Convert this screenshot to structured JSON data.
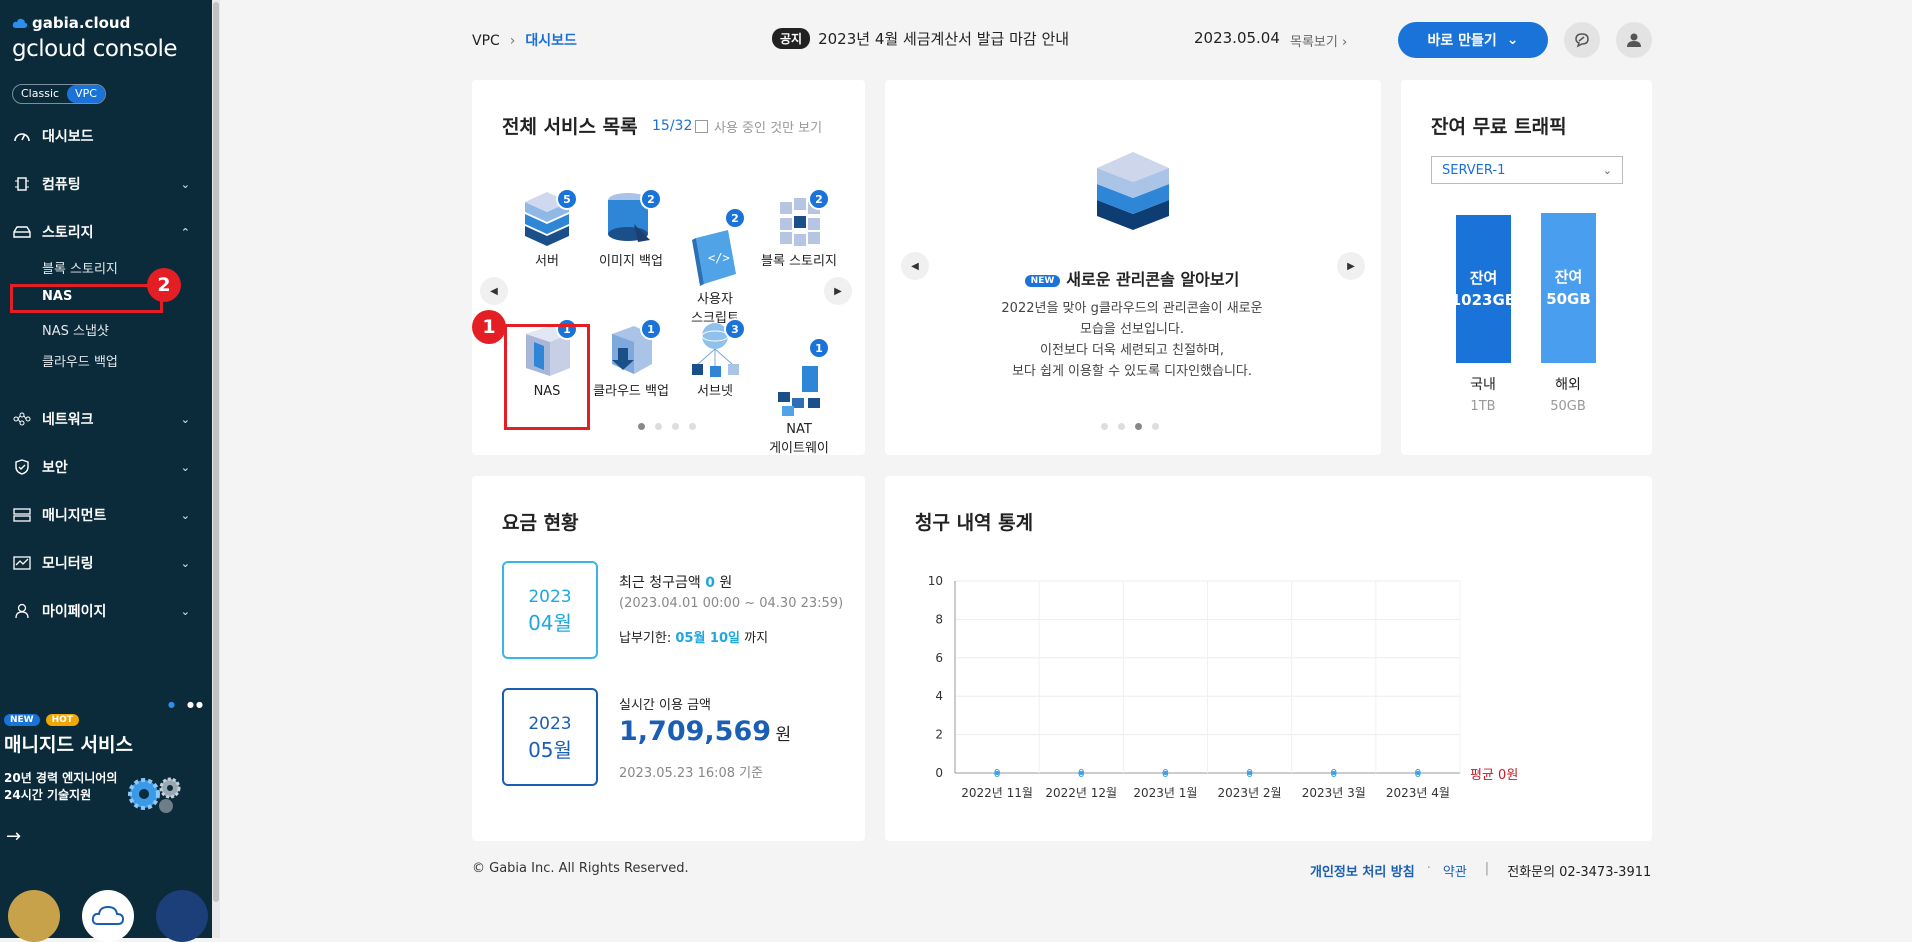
{
  "sidebar": {
    "logo_small": "gabia.cloud",
    "logo_main": "gcloud console",
    "toggle": [
      "Classic",
      "VPC"
    ],
    "menu": [
      {
        "label": "대시보드",
        "icon": "dashboard-icon"
      },
      {
        "label": "컴퓨팅",
        "icon": "chip-icon"
      },
      {
        "label": "스토리지",
        "icon": "storage-icon"
      },
      {
        "label": "네트워크",
        "icon": "network-icon"
      },
      {
        "label": "보안",
        "icon": "shield-icon"
      },
      {
        "label": "매니지먼트",
        "icon": "management-icon"
      },
      {
        "label": "모니터링",
        "icon": "monitoring-icon"
      },
      {
        "label": "마이페이지",
        "icon": "user-icon"
      }
    ],
    "storage_sub": [
      "블록 스토리지",
      "NAS",
      "NAS 스냅샷",
      "클라우드 백업"
    ],
    "promo": {
      "tag_new": "NEW",
      "tag_hot": "HOT",
      "title": "매니지드 서비스",
      "desc1": "20년 경력 엔지니어의",
      "desc2": "24시간 기술지원"
    }
  },
  "annotations": {
    "step1": "1",
    "step2": "2"
  },
  "header": {
    "breadcrumb_root": "VPC",
    "breadcrumb_current": "대시보드",
    "notice_label": "공지",
    "notice_text": "2023년 4월 세금계산서 발급 마감 안내",
    "notice_date": "2023.05.04",
    "notice_more": "목록보기",
    "create_button": "바로 만들기"
  },
  "services": {
    "title": "전체 서비스 목록",
    "count": "15/32",
    "filter_label": "사용 중인 것만 보기",
    "items": [
      {
        "name": "서버",
        "count": "5",
        "icon": "server-icon"
      },
      {
        "name": "이미지 백업",
        "count": "2",
        "icon": "image-backup-icon"
      },
      {
        "name": "사용자\n스크립트",
        "count": "2",
        "icon": "user-script-icon"
      },
      {
        "name": "블록 스토리지",
        "count": "2",
        "icon": "block-storage-icon"
      },
      {
        "name": "NAS",
        "count": "1",
        "icon": "nas-icon"
      },
      {
        "name": "클라우드 백업",
        "count": "1",
        "icon": "cloud-backup-icon"
      },
      {
        "name": "서브넷",
        "count": "3",
        "icon": "subnet-icon"
      },
      {
        "name": "NAT\n게이트웨이",
        "count": "1",
        "icon": "nat-gateway-icon"
      }
    ]
  },
  "slide": {
    "new_tag": "NEW",
    "title": "새로운 관리콘솔 알아보기",
    "lines": [
      "2022년을 맞아 g클라우드의 관리콘솔이 새로운",
      "모습을 선보입니다.",
      "이전보다 더욱 세련되고 친절하며,",
      "보다 쉽게 이용할 수 있도록 디자인했습니다."
    ]
  },
  "traffic": {
    "title": "잔여 무료 트래픽",
    "select": "SERVER-1",
    "domestic": {
      "bar": "잔여\n1023GB",
      "label": "국내",
      "sub": "1TB",
      "color": "#1a73d9"
    },
    "overseas": {
      "bar": "잔여\n50GB",
      "label": "해외",
      "sub": "50GB",
      "color": "#4a9ef0"
    }
  },
  "fee": {
    "title": "요금 현황",
    "recent": {
      "year": "2023",
      "month": "04월",
      "label_prefix": "최근 청구금액 ",
      "amount": "0",
      "label_suffix": " 원",
      "period": "(2023.04.01 00:00 ~ 04.30 23:59)",
      "due_prefix": "납부기한: ",
      "due_date": "05월 10일",
      "due_suffix": " 까지"
    },
    "realtime": {
      "year": "2023",
      "month": "05월",
      "label": "실시간 이용 금액",
      "amount": "1,709,569",
      "unit": "원",
      "asof": "2023.05.23 16:08 기준"
    }
  },
  "billing": {
    "title": "청구 내역 통계",
    "avg": "평균 0원"
  },
  "chart_data": {
    "type": "line",
    "categories": [
      "2022년 11월",
      "2022년 12월",
      "2023년 1월",
      "2023년 2월",
      "2023년 3월",
      "2023년 4월"
    ],
    "values": [
      0,
      0,
      0,
      0,
      0,
      0
    ],
    "ylim": [
      0,
      10
    ],
    "yticks": [
      "0",
      "2",
      "4",
      "6",
      "8",
      "10"
    ],
    "data_labels": [
      "0",
      "0",
      "0",
      "0",
      "0",
      "0"
    ],
    "grid": true
  },
  "footer": {
    "copyright": "© Gabia Inc. All Rights Reserved.",
    "privacy": "개인정보 처리 방침",
    "terms": "약관",
    "phone": "전화문의  02-3473-3911"
  }
}
